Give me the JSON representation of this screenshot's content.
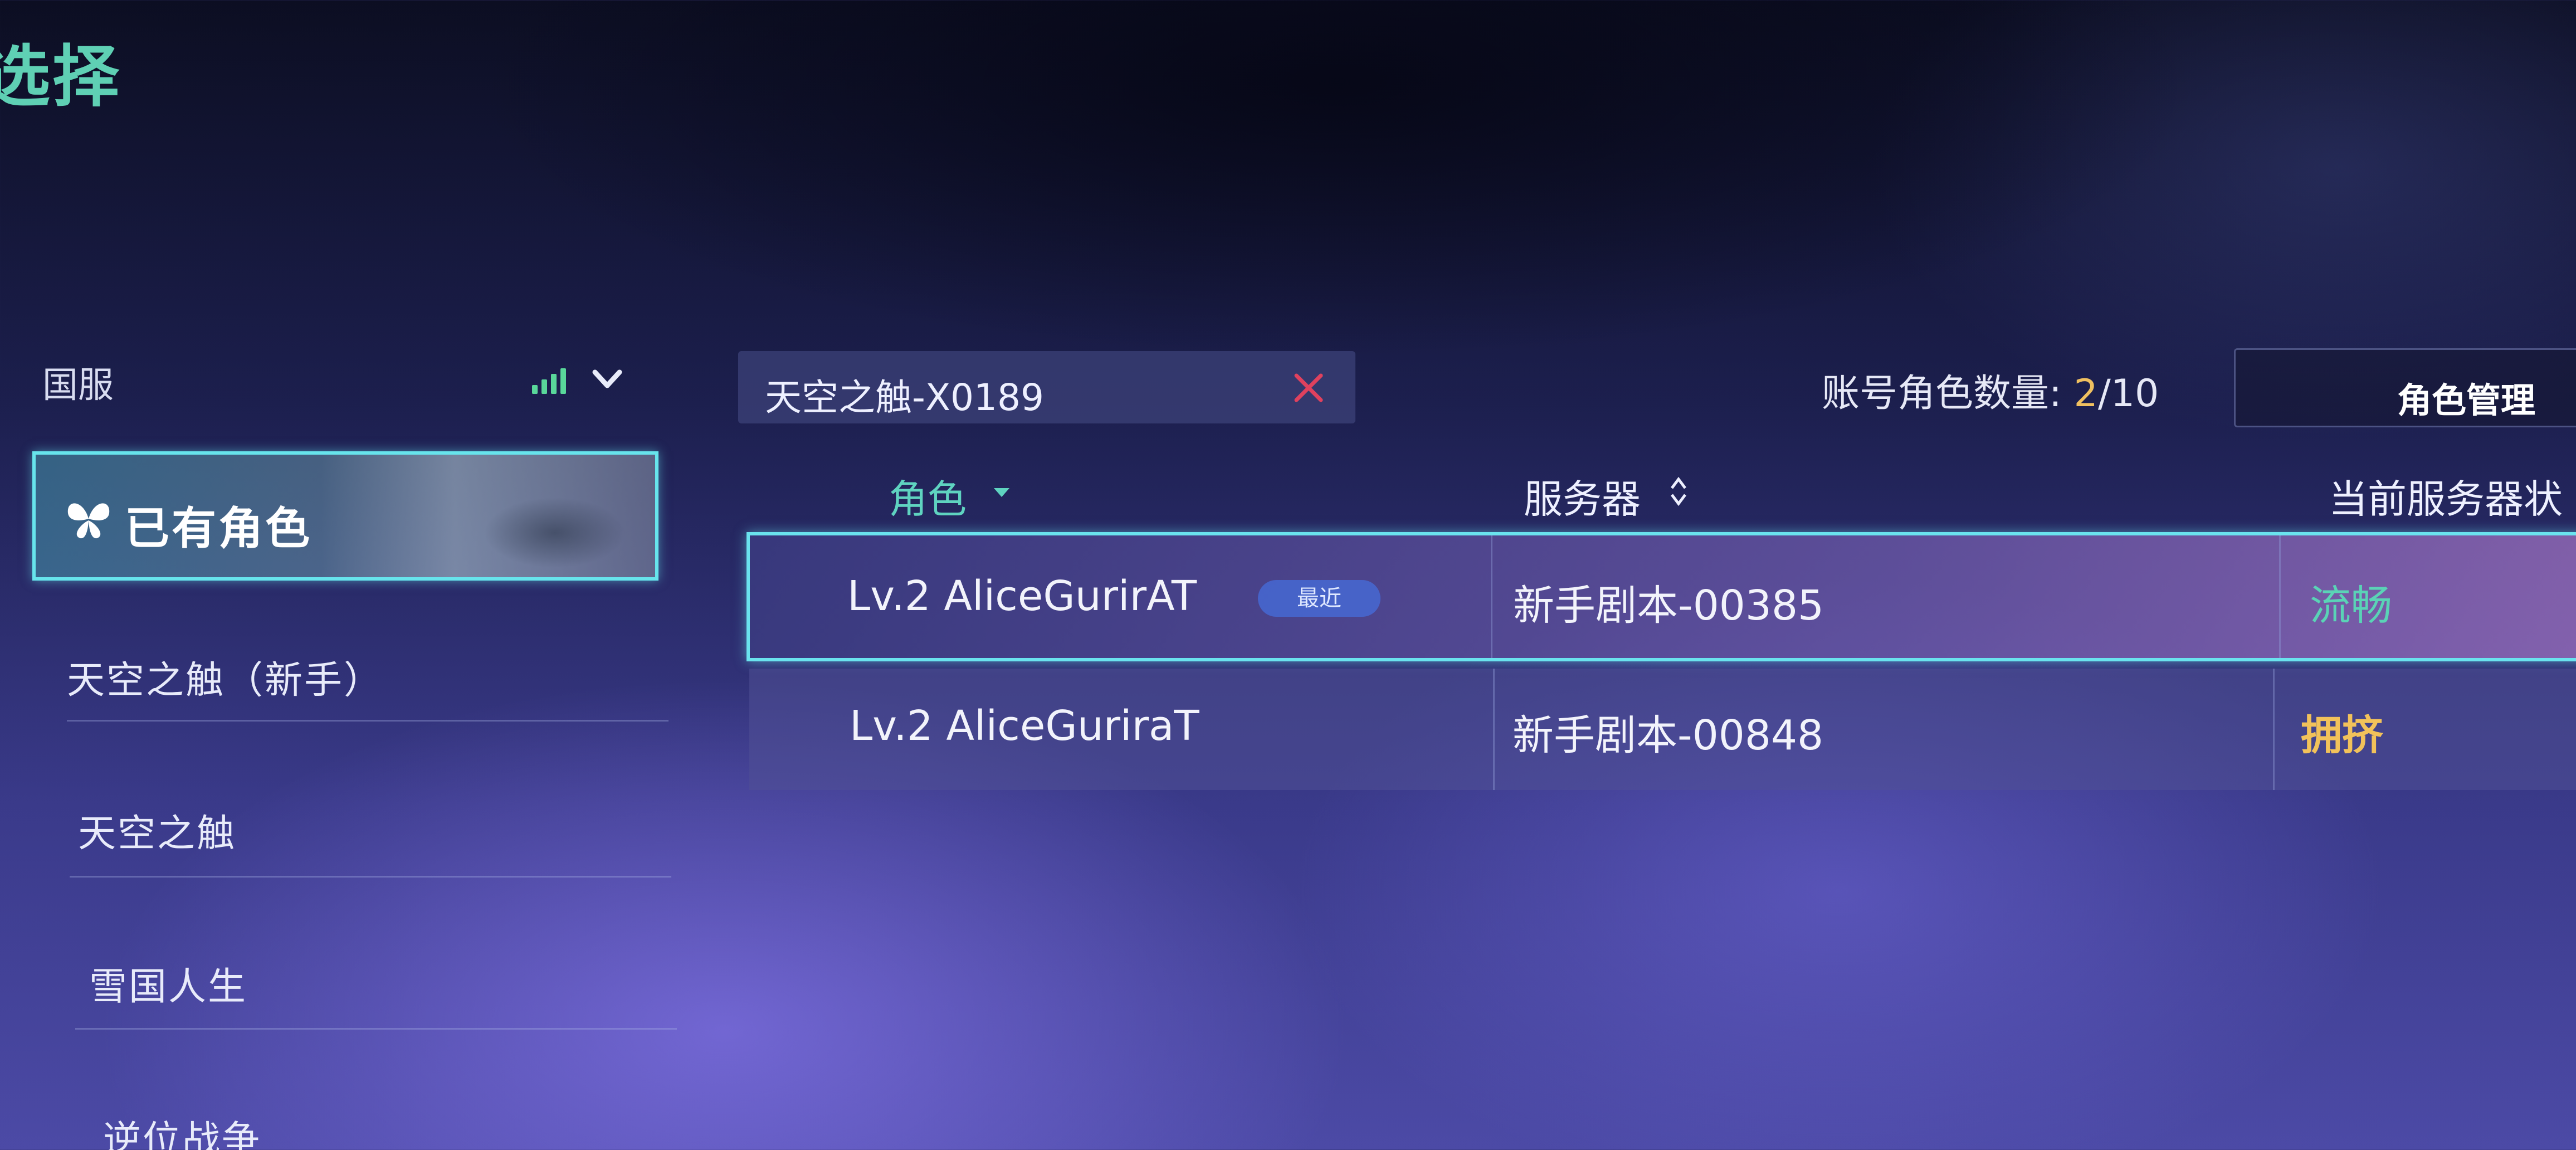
{
  "page": {
    "title": "选择"
  },
  "sidebar": {
    "region": "国服",
    "owned_tab": "已有角色",
    "servers": [
      "天空之触（新手）",
      "天空之触",
      "雪国人生",
      "逆位战争"
    ]
  },
  "search": {
    "value": "天空之触-X0189"
  },
  "account": {
    "count_label": "账号角色数量:",
    "count_current": "2",
    "count_total": "/10",
    "manage_button": "角色管理"
  },
  "table": {
    "headers": {
      "role": "角色",
      "server": "服务器",
      "status": "当前服务器状"
    },
    "rows": [
      {
        "name": "Lv.2 AliceGurirAT",
        "badge": "最近",
        "server": "新手剧本-00385",
        "status": "流畅"
      },
      {
        "name": "Lv.2 AliceGuriraT",
        "badge": "",
        "server": "新手剧本-00848",
        "status": "拥挤"
      }
    ]
  },
  "colors": {
    "accent_cyan": "#67e4ec",
    "title_green": "#5fd0b4",
    "status_smooth": "#5ad3b6",
    "status_crowded": "#f2c25a",
    "count_highlight": "#f0c060"
  }
}
